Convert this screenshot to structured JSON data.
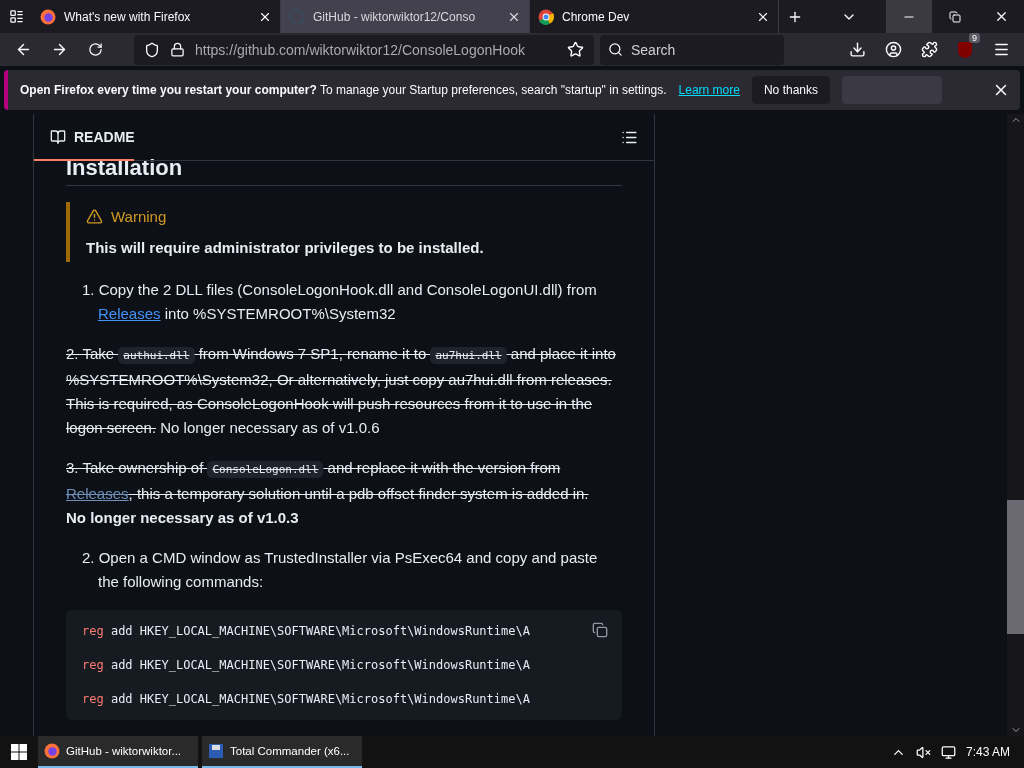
{
  "browser": {
    "tabs": [
      {
        "title": "What's new with Firefox",
        "selected": false
      },
      {
        "title": "GitHub - wiktorwiktor12/Conso",
        "selected": true
      },
      {
        "title": "Chrome Dev",
        "selected": false
      }
    ],
    "url": "https://github.com/wiktorwiktor12/ConsoleLogonHook",
    "search": {
      "placeholder": "Search"
    },
    "extension_badge": "9"
  },
  "notification": {
    "bold": "Open Firefox every time you restart your computer?",
    "text": "To manage your Startup preferences, search \"startup\" in settings.",
    "link": "Learn more",
    "buttons": [
      "No thanks"
    ]
  },
  "readme": {
    "title": "README",
    "heading": "Installation",
    "warning": {
      "title": "Warning",
      "text": "This will require administrator privileges to be installed."
    },
    "steps": [
      {
        "kind": "list",
        "number": "1.",
        "segments": [
          {
            "kind": "text",
            "struck": false,
            "text": "Copy the 2 DLL files (ConsoleLogonHook.dll and ConsoleLogonUI.dll) from "
          },
          {
            "kind": "link",
            "struck": false,
            "text": "Releases"
          },
          {
            "kind": "text",
            "struck": false,
            "text": " into %SYSTEMROOT%\\System32"
          }
        ]
      },
      {
        "kind": "para",
        "segments": [
          {
            "kind": "text",
            "struck": true,
            "text": "2. Take "
          },
          {
            "kind": "code",
            "struck": true,
            "text": "authui.dll"
          },
          {
            "kind": "text",
            "struck": true,
            "text": " from Windows 7 SP1, rename it to "
          },
          {
            "kind": "code",
            "struck": true,
            "text": "au7hui.dll"
          },
          {
            "kind": "text",
            "struck": true,
            "text": " and place it into %SYSTEMROOT%\\System32, Or alternatively, just copy au7hui.dll from releases. This is required, as ConsoleLogonHook will push resources from it to use in the logon screen."
          },
          {
            "kind": "text",
            "struck": false,
            "text": " No longer necessary as of v1.0.6"
          }
        ]
      },
      {
        "kind": "para",
        "segments": [
          {
            "kind": "text",
            "struck": true,
            "text": "3. Take ownership of "
          },
          {
            "kind": "code",
            "struck": true,
            "text": "ConsoleLogon.dll"
          },
          {
            "kind": "text",
            "struck": true,
            "text": " and replace it with the version from "
          },
          {
            "kind": "link",
            "struck": true,
            "text": "Releases"
          },
          {
            "kind": "text",
            "struck": true,
            "text": ", this a temporary solution until a pdb offset finder system is added in."
          },
          {
            "kind": "bold",
            "struck": false,
            "text": "No longer necessary as of v1.0.3"
          }
        ]
      },
      {
        "kind": "list",
        "number": "2.",
        "segments": [
          {
            "kind": "text",
            "struck": false,
            "text": "Open a CMD window as TrustedInstaller via PsExec64 and copy and paste the following commands:"
          }
        ]
      }
    ],
    "code": [
      {
        "keyword": "reg",
        "rest": " add HKEY_LOCAL_MACHINE\\SOFTWARE\\Microsoft\\WindowsRuntime\\A"
      },
      {
        "keyword": "reg",
        "rest": " add HKEY_LOCAL_MACHINE\\SOFTWARE\\Microsoft\\WindowsRuntime\\A"
      },
      {
        "keyword": "reg",
        "rest": " add HKEY_LOCAL_MACHINE\\SOFTWARE\\Microsoft\\WindowsRuntime\\A"
      }
    ]
  },
  "taskbar": {
    "tasks": [
      {
        "title": "GitHub - wiktorwiktor..."
      },
      {
        "title": "Total Commander (x6..."
      }
    ],
    "time": "7:43 AM"
  }
}
